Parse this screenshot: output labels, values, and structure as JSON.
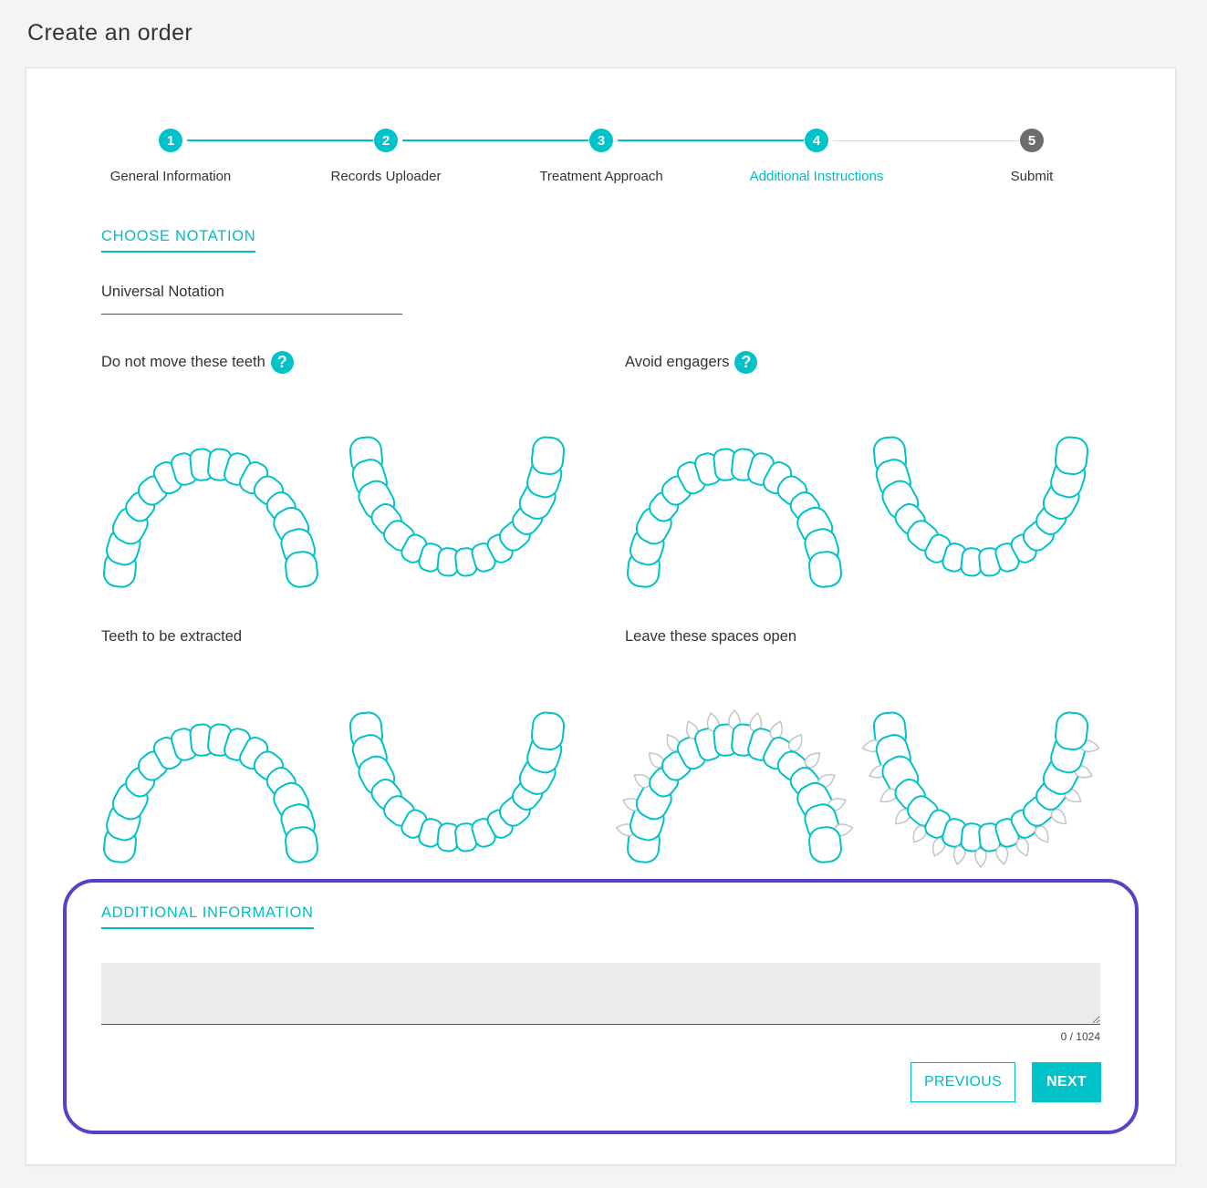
{
  "page": {
    "title": "Create an order"
  },
  "stepper": {
    "steps": [
      {
        "number": "1",
        "label": "General Information",
        "state": "complete"
      },
      {
        "number": "2",
        "label": "Records Uploader",
        "state": "complete"
      },
      {
        "number": "3",
        "label": "Treatment Approach",
        "state": "complete"
      },
      {
        "number": "4",
        "label": "Additional Instructions",
        "state": "active"
      },
      {
        "number": "5",
        "label": "Submit",
        "state": "pending"
      }
    ]
  },
  "notation": {
    "section_title": "CHOOSE NOTATION",
    "selected": "Universal Notation"
  },
  "charts": {
    "do_not_move": {
      "label": "Do not move these teeth",
      "help_icon": "?"
    },
    "avoid_engagers": {
      "label": "Avoid engagers",
      "help_icon": "?"
    },
    "extract": {
      "label": "Teeth to be extracted"
    },
    "spaces_open": {
      "label": "Leave these spaces open"
    }
  },
  "additional_info": {
    "section_title": "ADDITIONAL INFORMATION",
    "value": "",
    "counter": "0 / 1024"
  },
  "actions": {
    "previous_label": "PREVIOUS",
    "next_label": "NEXT"
  },
  "colors": {
    "accent": "#00c2c9",
    "pending_step": "#6d6d6d",
    "highlight_border": "#5b3fc4",
    "space_marker": "#c4c4c4"
  }
}
